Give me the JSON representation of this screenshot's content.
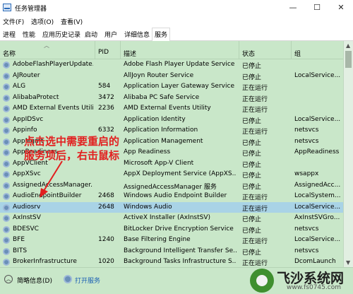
{
  "window": {
    "title": "任务管理器",
    "minimize": "—",
    "maximize": "☐",
    "close": "✕"
  },
  "menu": [
    "文件(F)",
    "选项(O)",
    "查看(V)"
  ],
  "tabs": [
    "进程",
    "性能",
    "应用历史记录",
    "启动",
    "用户",
    "详细信息",
    "服务"
  ],
  "active_tab": "服务",
  "columns": {
    "name": "名称",
    "pid": "PID",
    "desc": "描述",
    "status": "状态",
    "group": "组"
  },
  "services": [
    {
      "name": "AdobeFlashPlayerUpdate...",
      "pid": "",
      "desc": "Adobe Flash Player Update Service",
      "status": "已停止",
      "group": ""
    },
    {
      "name": "AJRouter",
      "pid": "",
      "desc": "AllJoyn Router Service",
      "status": "已停止",
      "group": "LocalService..."
    },
    {
      "name": "ALG",
      "pid": "584",
      "desc": "Application Layer Gateway Service",
      "status": "正在运行",
      "group": ""
    },
    {
      "name": "AlibabaProtect",
      "pid": "3472",
      "desc": "Alibaba PC Safe Service",
      "status": "正在运行",
      "group": ""
    },
    {
      "name": "AMD External Events Utili...",
      "pid": "2236",
      "desc": "AMD External Events Utility",
      "status": "正在运行",
      "group": ""
    },
    {
      "name": "AppIDSvc",
      "pid": "",
      "desc": "Application Identity",
      "status": "已停止",
      "group": "LocalService..."
    },
    {
      "name": "Appinfo",
      "pid": "6332",
      "desc": "Application Information",
      "status": "正在运行",
      "group": "netsvcs"
    },
    {
      "name": "AppMgmt",
      "pid": "",
      "desc": "Application Management",
      "status": "已停止",
      "group": "netsvcs"
    },
    {
      "name": "AppReadiness",
      "pid": "",
      "desc": "App Readiness",
      "status": "已停止",
      "group": "AppReadiness"
    },
    {
      "name": "AppVClient",
      "pid": "",
      "desc": "Microsoft App-V Client",
      "status": "已停止",
      "group": ""
    },
    {
      "name": "AppXSvc",
      "pid": "",
      "desc": "AppX Deployment Service (AppXS...",
      "status": "已停止",
      "group": "wsappx"
    },
    {
      "name": "AssignedAccessManager...",
      "pid": "",
      "desc": "AssignedAccessManager 服务",
      "status": "已停止",
      "group": "AssignedAcc..."
    },
    {
      "name": "AudioEndpointBuilder",
      "pid": "2468",
      "desc": "Windows Audio Endpoint Builder",
      "status": "正在运行",
      "group": "LocalSystem..."
    },
    {
      "name": "Audiosrv",
      "pid": "2648",
      "desc": "Windows Audio",
      "status": "正在运行",
      "group": "LocalService..."
    },
    {
      "name": "AxInstSV",
      "pid": "",
      "desc": "ActiveX Installer (AxInstSV)",
      "status": "已停止",
      "group": "AxInstSVGro..."
    },
    {
      "name": "BDESVC",
      "pid": "",
      "desc": "BitLocker Drive Encryption Service",
      "status": "已停止",
      "group": "netsvcs"
    },
    {
      "name": "BFE",
      "pid": "1240",
      "desc": "Base Filtering Engine",
      "status": "正在运行",
      "group": "LocalService..."
    },
    {
      "name": "BITS",
      "pid": "",
      "desc": "Background Intelligent Transfer Se...",
      "status": "已停止",
      "group": "netsvcs"
    },
    {
      "name": "BrokerInfrastructure",
      "pid": "1020",
      "desc": "Background Tasks Infrastructure S...",
      "status": "正在运行",
      "group": "DcomLaunch"
    }
  ],
  "selected_service": "Audiosrv",
  "annotation": {
    "line1": "点击选中需要重启的",
    "line2": "服务项后，右击鼠标",
    "color": "#e21f1f"
  },
  "footer": {
    "summary": "简略信息(D)",
    "open_services": "打开服务"
  },
  "watermark": {
    "name": "飞沙系统网",
    "url": "www.fs0745.com"
  }
}
